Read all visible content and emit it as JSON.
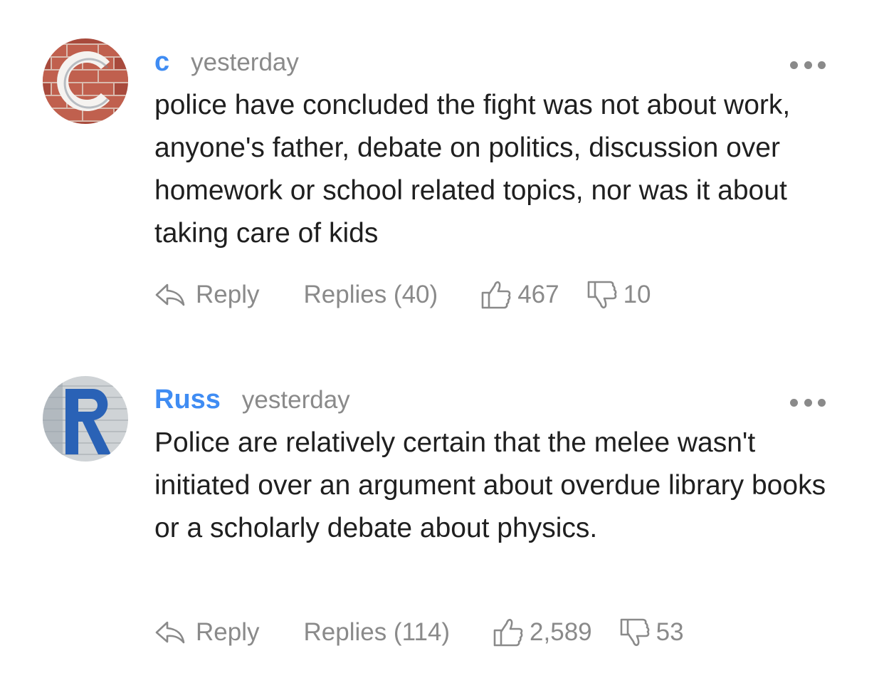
{
  "comments": [
    {
      "avatar_letter": "C",
      "author": "c",
      "time": "yesterday",
      "text": "police have concluded the fight was not about work, anyone's father, debate on politics, discussion over homework or school related topics, nor was it about taking care of kids",
      "reply_label": "Reply",
      "replies_label": "Replies (40)",
      "likes": "467",
      "dislikes": "10"
    },
    {
      "avatar_letter": "R",
      "author": "Russ",
      "time": "yesterday",
      "text": "Police are relatively certain that the melee wasn't initiated over an argument about overdue library books or a scholarly debate about physics.",
      "reply_label": "Reply",
      "replies_label": "Replies (114)",
      "likes": "2,589",
      "dislikes": "53"
    }
  ],
  "icons": {
    "more": "more-dots-icon",
    "reply": "reply-arrow-icon",
    "like": "thumbs-up-icon",
    "dislike": "thumbs-down-icon"
  },
  "colors": {
    "author": "#3f8cf3",
    "muted": "#8a8a8a",
    "text": "#1f1f1f"
  }
}
